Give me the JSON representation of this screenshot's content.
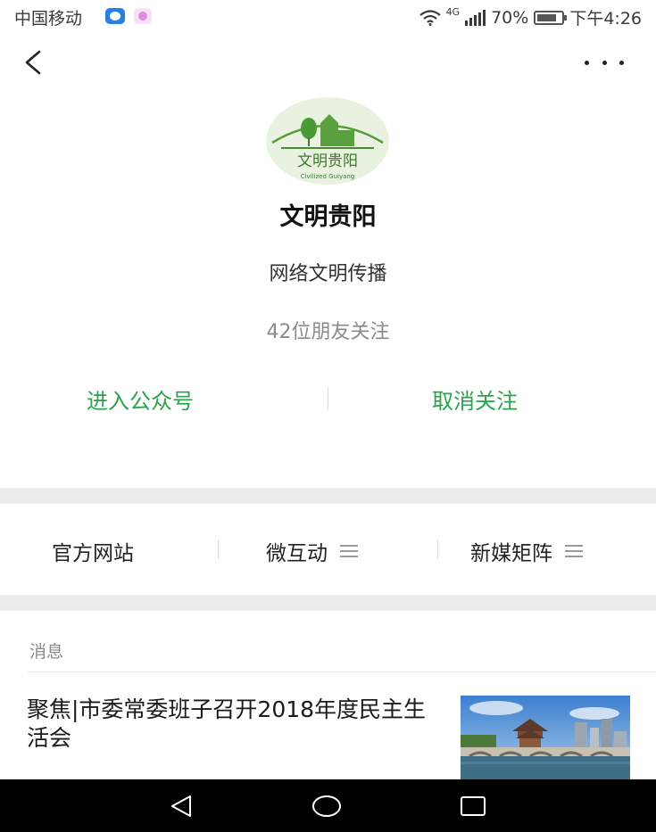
{
  "status_bar": {
    "carrier": "中国移动",
    "network": "4G",
    "battery": "70%",
    "time": "下午4:26"
  },
  "account": {
    "logo_text_cn": "文明贵阳",
    "logo_text_en": "Civilized Guiyang",
    "name": "文明贵阳",
    "description": "网络文明传播",
    "followers": "42位朋友关注"
  },
  "actions": {
    "enter": "进入公众号",
    "unfollow": "取消关注"
  },
  "menu": {
    "items": [
      {
        "label": "官方网站",
        "has_submenu": false
      },
      {
        "label": "微互动",
        "has_submenu": true
      },
      {
        "label": "新媒矩阵",
        "has_submenu": true
      }
    ]
  },
  "messages": {
    "section_label": "消息",
    "items": [
      {
        "title": "聚焦|市委常委班子召开2018年度民主生活会"
      }
    ]
  },
  "colors": {
    "accent_green": "#2aa14a",
    "divider": "#ededed"
  },
  "icons": [
    "back-icon",
    "more-icon",
    "wifi-icon",
    "signal-icon",
    "battery-icon",
    "menu-burger-icon",
    "nav-back-icon",
    "nav-home-icon",
    "nav-recents-icon"
  ]
}
